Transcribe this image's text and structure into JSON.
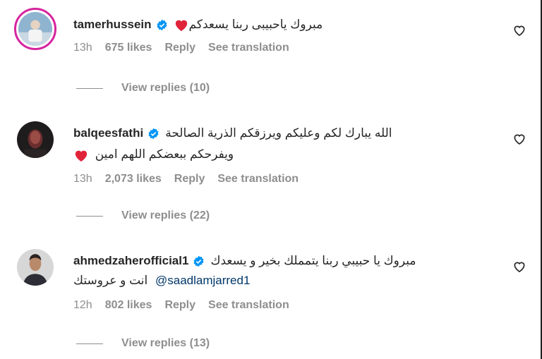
{
  "comments": [
    {
      "username": "tamerhussein",
      "text": "مبروك ياحبيبى ربنا يسعدكم",
      "time": "13h",
      "likes": "675 likes",
      "reply": "Reply",
      "translate": "See translation",
      "view_replies": "View replies (10)"
    },
    {
      "username": "balqeesfathi",
      "text": "الله يبارك لكم وعليكم ويرزقكم الذرية الصالحة",
      "text2": "ويفرحكم ببعضكم اللهم امين",
      "time": "13h",
      "likes": "2,073 likes",
      "reply": "Reply",
      "translate": "See translation",
      "view_replies": "View replies (22)"
    },
    {
      "username": "ahmedzaherofficial1",
      "text": "مبروك يا حبيبي ربنا يتمملك بخير و يسعدك",
      "mention": "@saadlamjarred1",
      "text2": "انت و عروستك",
      "time": "12h",
      "likes": "802 likes",
      "reply": "Reply",
      "translate": "See translation",
      "view_replies": "View replies (13)"
    }
  ],
  "icons": {
    "verified": "verified-badge-icon",
    "like": "heart-outline-icon",
    "emoji": "red-heart-emoji"
  },
  "colors": {
    "verified": "#0095f6",
    "muted": "#8e8e8e",
    "mention": "#00376b",
    "heart": "#e0243a"
  }
}
